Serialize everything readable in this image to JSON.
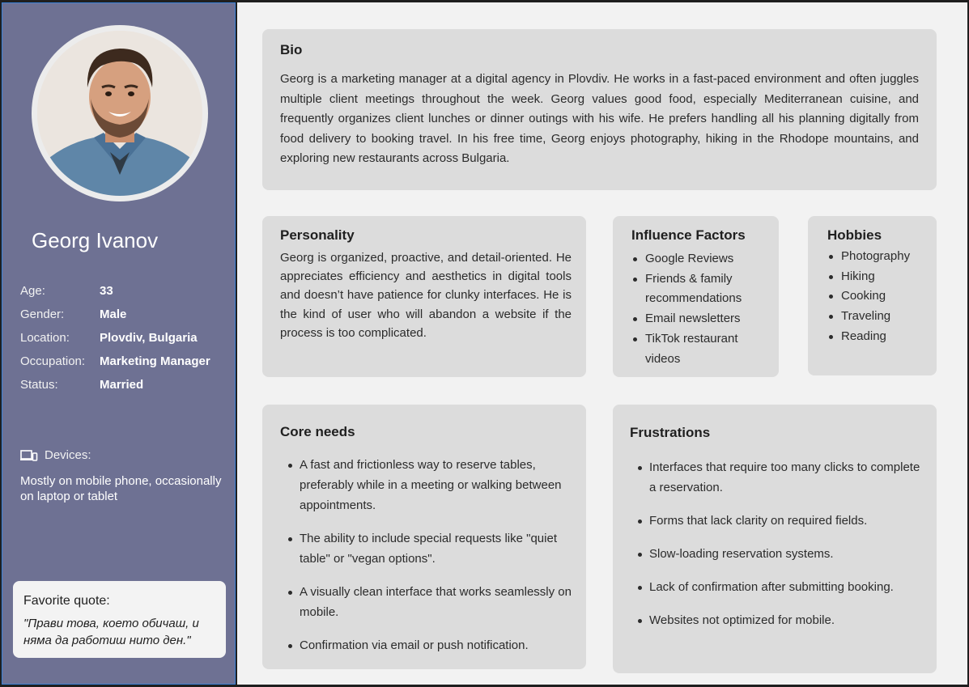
{
  "persona": {
    "name": "Georg Ivanov",
    "facts": [
      {
        "label": "Age:",
        "value": "33"
      },
      {
        "label": "Gender:",
        "value": "Male"
      },
      {
        "label": "Location:",
        "value": "Plovdiv, Bulgaria"
      },
      {
        "label": "Occupation:",
        "value": "Marketing Manager"
      },
      {
        "label": "Status:",
        "value": "Married"
      }
    ],
    "devices_label": "Devices:",
    "devices_text": "Mostly on mobile phone, occasionally on laptop or tablet",
    "quote_title": "Favorite quote:",
    "quote_text": "\"Прави това, което обичаш, и няма да работиш нито ден.\""
  },
  "bio": {
    "title": "Bio",
    "text": "Georg is a marketing manager at a digital agency in Plovdiv. He works in a fast-paced environment and often juggles multiple client meetings throughout the week. Georg values good food, especially Mediterranean cuisine, and frequently organizes client lunches or dinner outings with his wife. He prefers handling all his planning digitally from food delivery to booking travel. In his free time, Georg enjoys photography, hiking in the Rhodope mountains, and exploring new restaurants across Bulgaria."
  },
  "personality": {
    "title": "Personality",
    "text": "Georg is organized, proactive, and detail-oriented. He appreciates efficiency and aesthetics in digital tools and doesn’t have patience for clunky interfaces. He is the kind of user who will abandon a website if the process is too complicated."
  },
  "influence": {
    "title": "Influence Factors",
    "items": [
      "Google Reviews",
      "Friends & family recommendations",
      "Email newsletters",
      "TikTok restaurant videos"
    ]
  },
  "hobbies": {
    "title": "Hobbies",
    "items": [
      "Photography",
      "Hiking",
      "Cooking",
      "Traveling",
      "Reading"
    ]
  },
  "core_needs": {
    "title": "Core needs",
    "items": [
      "A fast and frictionless way to reserve tables, preferably while in a meeting or walking between appointments.",
      "The ability to include special requests like \"quiet table\" or \"vegan options\".",
      "A visually clean interface that works seamlessly on mobile.",
      "Confirmation via email or push notification."
    ]
  },
  "frustrations": {
    "title": "Frustrations",
    "items": [
      "Interfaces that require too many clicks to complete a reservation.",
      "Forms that lack clarity on required fields.",
      "Slow-loading reservation systems.",
      "Lack of confirmation after submitting booking.",
      "Websites not optimized for mobile."
    ]
  },
  "colors": {
    "sidebar": "#6e7193",
    "main_bg": "#f2f2f2",
    "card_bg": "#dcdcdc",
    "quote_bg": "#f3f3f3",
    "sidebar_border": "#3b82d9"
  }
}
